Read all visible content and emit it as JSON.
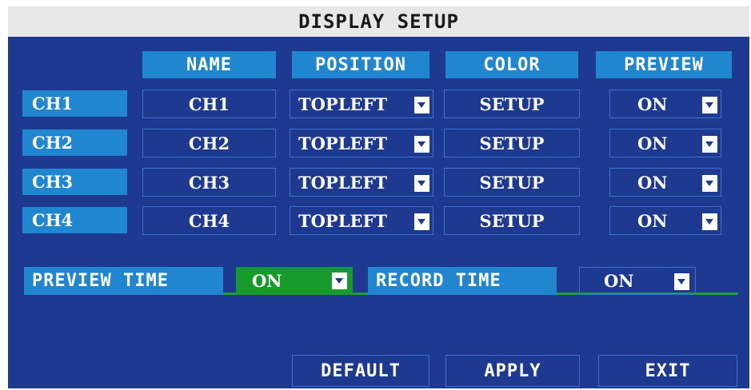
{
  "title": "DISPLAY SETUP",
  "headers": {
    "name": "NAME",
    "position": "POSITION",
    "color": "COLOR",
    "preview": "PREVIEW"
  },
  "channels": [
    {
      "label": "CH1",
      "name": "CH1",
      "position": "TOPLEFT",
      "color": "SETUP",
      "preview": "ON"
    },
    {
      "label": "CH2",
      "name": "CH2",
      "position": "TOPLEFT",
      "color": "SETUP",
      "preview": "ON"
    },
    {
      "label": "CH3",
      "name": "CH3",
      "position": "TOPLEFT",
      "color": "SETUP",
      "preview": "ON"
    },
    {
      "label": "CH4",
      "name": "CH4",
      "position": "TOPLEFT",
      "color": "SETUP",
      "preview": "ON"
    }
  ],
  "preview_time": {
    "label": "PREVIEW TIME",
    "value": "ON"
  },
  "record_time": {
    "label": "RECORD TIME",
    "value": "ON"
  },
  "buttons": {
    "default": "DEFAULT",
    "apply": "APPLY",
    "exit": "EXIT"
  },
  "colors": {
    "panel": "#1d3990",
    "header": "#1f86cf",
    "title_bar": "#e8e8e8",
    "active_green": "#169a2a",
    "divider": "#1aa32a"
  },
  "icons": {
    "dropdown": "chevron-down-icon"
  }
}
